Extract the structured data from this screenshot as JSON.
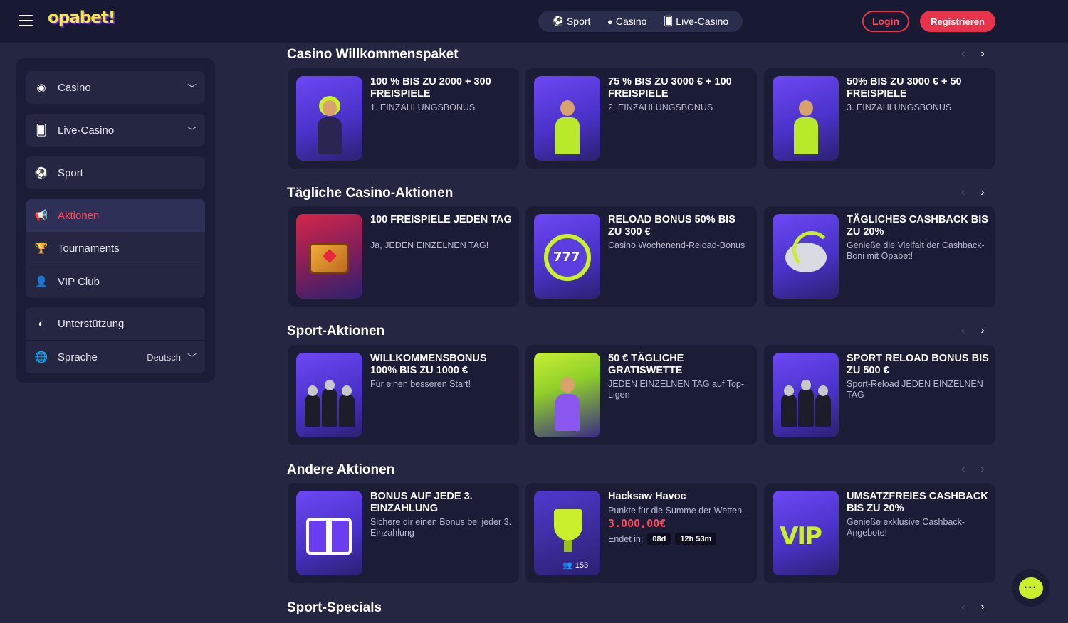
{
  "header": {
    "logo": "opabet!",
    "nav": [
      {
        "label": "Sport",
        "icon": "soccer-ball-icon"
      },
      {
        "label": "Casino",
        "icon": "poker-chip-icon"
      },
      {
        "label": "Live-Casino",
        "icon": "cards-icon"
      }
    ],
    "login": "Login",
    "register": "Registrieren"
  },
  "sidebar": {
    "items": [
      {
        "label": "Casino",
        "icon": "poker-chip-icon"
      },
      {
        "label": "Live-Casino",
        "icon": "cards-icon"
      },
      {
        "label": "Sport",
        "icon": "soccer-ball-icon"
      },
      {
        "label": "Aktionen",
        "icon": "megaphone-icon"
      },
      {
        "label": "Tournaments",
        "icon": "trophy-icon"
      },
      {
        "label": "VIP Club",
        "icon": "user-icon"
      },
      {
        "label": "Unterstützung",
        "icon": "support-icon"
      },
      {
        "label": "Sprache",
        "icon": "globe-icon",
        "value": "Deutsch"
      }
    ]
  },
  "sections": [
    {
      "title": "Casino Willkommenspaket",
      "cards": [
        {
          "title": "100 % BIS ZU 2000  + 300 FREISPIELE",
          "desc": "1. EINZAHLUNGSBONUS"
        },
        {
          "title": "75 % BIS ZU 3000 € + 100 FREISPIELE",
          "desc": "2. EINZAHLUNGSBONUS"
        },
        {
          "title": "50% BIS ZU 3000 € + 50 FREISPIELE",
          "desc": "3. EINZAHLUNGSBONUS"
        }
      ]
    },
    {
      "title": "Tägliche Casino-Aktionen",
      "cards": [
        {
          "title": "100 FREISPIELE JEDEN TAG",
          "desc": "Ja, JEDEN EINZELNEN TAG!"
        },
        {
          "title": "RELOAD BONUS 50% BIS ZU 300 €",
          "desc": "Casino Wochenend-Reload-Bonus"
        },
        {
          "title": "TÄGLICHES CASHBACK BIS ZU 20%",
          "desc": "Genieße die Vielfalt der Cashback-Boni mit Opabet!"
        }
      ]
    },
    {
      "title": "Sport-Aktionen",
      "cards": [
        {
          "title": "WILLKOMMENSBONUS 100% BIS ZU 1000 €",
          "desc": "Für einen besseren Start!"
        },
        {
          "title": "50 € TÄGLICHE GRATISWETTE",
          "desc": "JEDEN EINZELNEN TAG auf Top-Ligen"
        },
        {
          "title": "SPORT RELOAD BONUS BIS ZU 500 €",
          "desc": "Sport-Reload JEDEN EINZELNEN TAG"
        }
      ]
    },
    {
      "title": "Andere Aktionen",
      "cards": [
        {
          "title": "BONUS AUF JEDE 3. EINZAHLUNG",
          "desc": "Sichere dir einen Bonus bei jeder 3. Einzahlung"
        },
        {
          "title": "Hacksaw Havoc",
          "desc": "Punkte für die Summe der Wetten",
          "prize": "3.000,00€",
          "ends_label": "Endet in:",
          "days": "08d",
          "time": "12h 53m",
          "players": "153"
        },
        {
          "title": "UMSATZFREIES CASHBACK BIS ZU 20%",
          "desc": "Genieße exklusive Cashback-Angebote!"
        }
      ]
    },
    {
      "title": "Sport-Specials"
    }
  ],
  "chat": {
    "icon": "chat-bubble-icon"
  }
}
